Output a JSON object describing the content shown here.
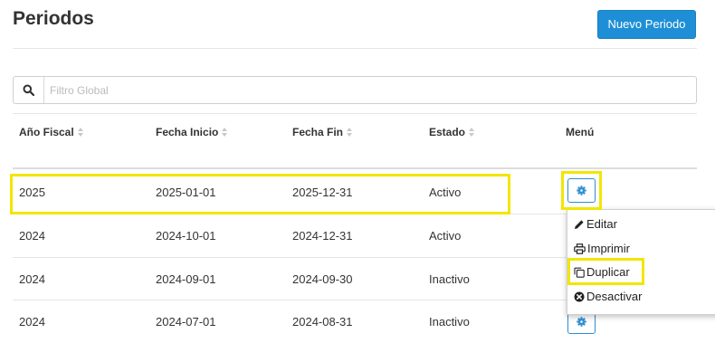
{
  "page": {
    "title": "Periodos"
  },
  "toolbar": {
    "new_button": "Nuevo Periodo"
  },
  "search": {
    "placeholder": "Filtro Global",
    "value": ""
  },
  "table": {
    "headers": [
      "Año Fiscal",
      "Fecha Inicio",
      "Fecha Fin",
      "Estado",
      "Menú"
    ],
    "rows": [
      [
        "2025",
        "2025-01-01",
        "2025-12-31",
        "Activo"
      ],
      [
        "2024",
        "2024-10-01",
        "2024-12-31",
        "Activo"
      ],
      [
        "2024",
        "2024-09-01",
        "2024-09-30",
        "Inactivo"
      ],
      [
        "2024",
        "2024-07-01",
        "2024-08-31",
        "Inactivo"
      ]
    ]
  },
  "context_menu": {
    "items": [
      "Editar",
      "Imprimir",
      "Duplicar",
      "Desactivar"
    ]
  },
  "colors": {
    "primary": "#1e8fd6",
    "highlight": "#f2e600"
  }
}
